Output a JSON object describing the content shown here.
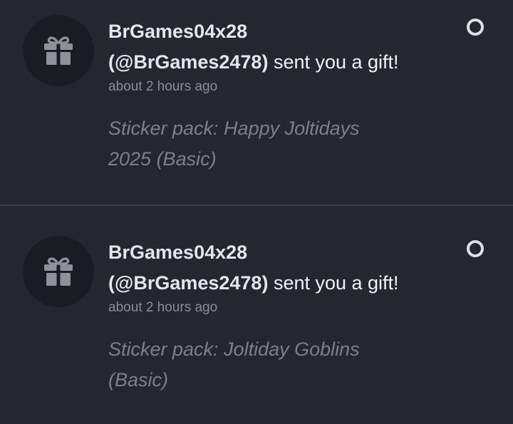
{
  "notifications": [
    {
      "username": "BrGames04x28",
      "handle": "(@BrGames2478)",
      "action": "sent you a gift!",
      "timestamp": "about 2 hours ago",
      "detail": "Sticker pack: Happy Joltidays 2025 (Basic)",
      "icon": "gift-icon",
      "unread_icon": "unread-circle-icon"
    },
    {
      "username": "BrGames04x28",
      "handle": "(@BrGames2478)",
      "action": "sent you a gift!",
      "timestamp": "about 2 hours ago",
      "detail": "Sticker pack: Joltiday Goblins (Basic)",
      "icon": "gift-icon",
      "unread_icon": "unread-circle-icon"
    }
  ],
  "colors": {
    "background": "#25262f",
    "avatar_bg": "#1b1c23",
    "icon": "#8f909a",
    "divider": "#3e3f49"
  }
}
